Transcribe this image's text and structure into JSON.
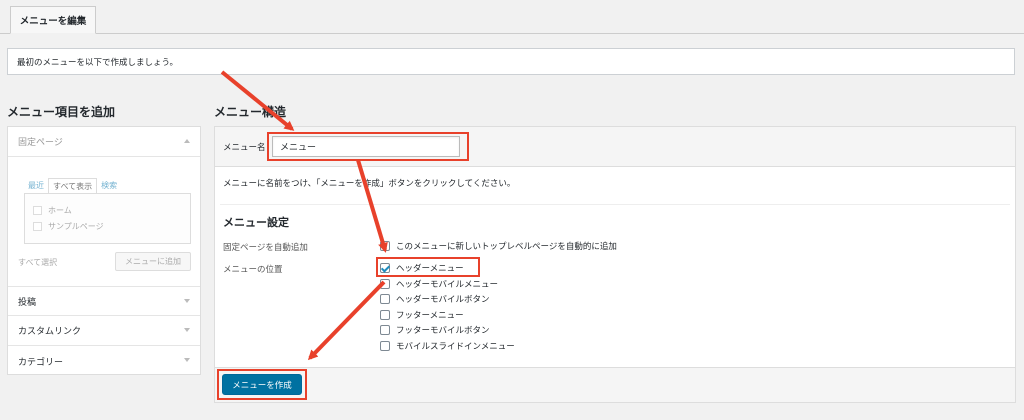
{
  "tabs": {
    "edit_menu": "メニューを編集"
  },
  "notice": {
    "text": "最初のメニューを以下で作成しましょう。"
  },
  "left": {
    "heading": "メニュー項目を追加",
    "sections": [
      {
        "label": "固定ページ"
      },
      {
        "label": "投稿"
      },
      {
        "label": "カスタムリンク"
      },
      {
        "label": "カテゴリー"
      }
    ],
    "page_tabs": [
      "最近",
      "すべて表示",
      "検索"
    ],
    "pages": [
      "ホーム",
      "サンプルページ"
    ],
    "select_all": "すべて選択",
    "add_to_menu": "メニューに追加"
  },
  "right": {
    "heading": "メニュー構造",
    "menu_name_label": "メニュー名",
    "menu_name_value": "メニュー",
    "instruction": "メニューに名前をつけ、「メニューを作成」ボタンをクリックしてください。",
    "settings_heading": "メニュー設定",
    "auto_add_label": "固定ページを自動追加",
    "auto_add_option": "このメニューに新しいトップレベルページを自動的に追加",
    "location_label": "メニューの位置",
    "locations": [
      {
        "label": "ヘッダーメニュー",
        "checked": true
      },
      {
        "label": "ヘッダーモバイルメニュー",
        "checked": false
      },
      {
        "label": "ヘッダーモバイルボタン",
        "checked": false
      },
      {
        "label": "フッターメニュー",
        "checked": false
      },
      {
        "label": "フッターモバイルボタン",
        "checked": false
      },
      {
        "label": "モバイルスライドインメニュー",
        "checked": false
      }
    ],
    "create_button": "メニューを作成"
  },
  "colors": {
    "accent": "#0071a1",
    "highlight": "#e8412b",
    "background": "#f1f1f1"
  }
}
